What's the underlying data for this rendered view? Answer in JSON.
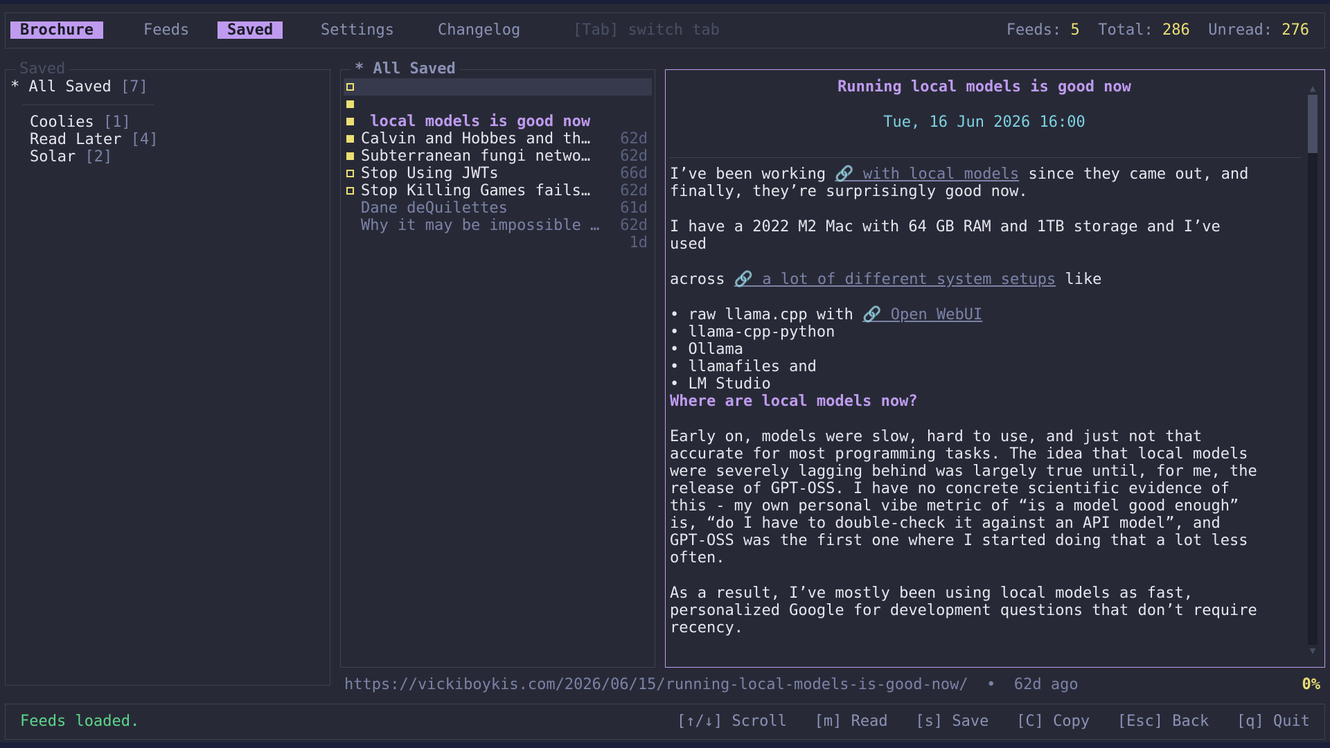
{
  "tabs": [
    "Brochure",
    "Feeds",
    "Saved",
    "Settings",
    "Changelog"
  ],
  "tab_hint": "[Tab] switch tab",
  "stats": {
    "feeds_label": "Feeds:",
    "feeds_value": "5",
    "total_label": "Total:",
    "total_value": "286",
    "unread_label": "Unread:",
    "unread_value": "276"
  },
  "folders": {
    "title": "Saved",
    "all": {
      "marker": "*",
      "label": "All Saved",
      "count": "[7]"
    },
    "items": [
      {
        "label": "Coolies",
        "count": "[1]"
      },
      {
        "label": "Read Later",
        "count": "[4]"
      },
      {
        "label": "Solar",
        "count": "[2]"
      }
    ]
  },
  "list": {
    "title": "* All Saved",
    "items": [
      {
        "title": " local models is good now",
        "age": "62d"
      },
      {
        "title": "Calvin and Hobbes and th…",
        "age": "62d"
      },
      {
        "title": "Subterranean fungi netwo…",
        "age": "66d"
      },
      {
        "title": "Stop Using JWTs",
        "age": "62d"
      },
      {
        "title": "Stop Killing Games fails…",
        "age": "61d"
      },
      {
        "title": "Dane deQuilettes",
        "age": "62d"
      },
      {
        "title": "Why it may be impossible …",
        "age": "1d"
      }
    ]
  },
  "article": {
    "title": "Running local models is good now",
    "date": "Tue, 16 Jun 2026 16:00",
    "p1a": "I’ve been working ",
    "p1_link": "🔗 with local models",
    "p1b": " since they came out, and",
    "p1c": "finally, they’re surprisingly good now.",
    "p2a": "I have a 2022 M2 Mac with 64 GB RAM and 1TB storage and I’ve",
    "p2b": "used",
    "p3a": "across ",
    "p3_link": "🔗 a lot of different system setups",
    "p3b": " like",
    "b1a": "• raw llama.cpp with ",
    "b1_link": "🔗 Open WebUI",
    "b2": "• llama-cpp-python",
    "b3": "• Ollama",
    "b4": "• llamafiles and",
    "b5": "• LM Studio",
    "h2": "Where are local models now?",
    "p4": [
      "Early on, models were slow, hard to use, and just not that",
      "accurate for most programming tasks. The idea that local models",
      "were severely lagging behind was largely true until, for me, the",
      "release of GPT-OSS. I have no concrete scientific evidence of",
      "this - my own personal vibe metric of “is a model good enough”",
      "is, “do I have to double-check it against an API model”, and",
      "GPT-OSS was the first one where I started doing that a lot less",
      "often."
    ],
    "p5": [
      "As a result, I’ve mostly been using local models as fast,",
      "personalized Google for development questions that don’t require",
      "recency."
    ]
  },
  "url_line": "https://vickiboykis.com/2026/06/15/running-local-models-is-good-now/  •  62d ago",
  "scroll_pct": "0%",
  "status": "Feeds loaded.",
  "keys": [
    "[↑/↓] Scroll",
    "[m] Read",
    "[s] Save",
    "[C] Copy",
    "[Esc] Back",
    "[q] Quit"
  ]
}
